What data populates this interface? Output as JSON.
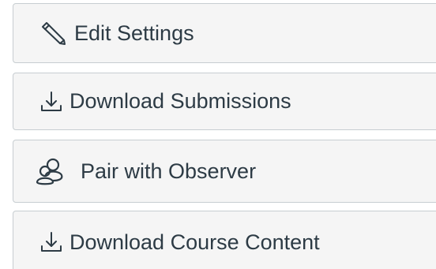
{
  "actions": [
    {
      "label": "Edit Settings",
      "icon": "pencil-icon"
    },
    {
      "label": "Download Submissions",
      "icon": "download-icon"
    },
    {
      "label": "Pair with Observer",
      "icon": "users-icon"
    },
    {
      "label": "Download Course Content",
      "icon": "download-icon"
    }
  ],
  "colors": {
    "button_background": "#f5f5f5",
    "button_border": "#c7cdd1",
    "text": "#2d3b45"
  }
}
